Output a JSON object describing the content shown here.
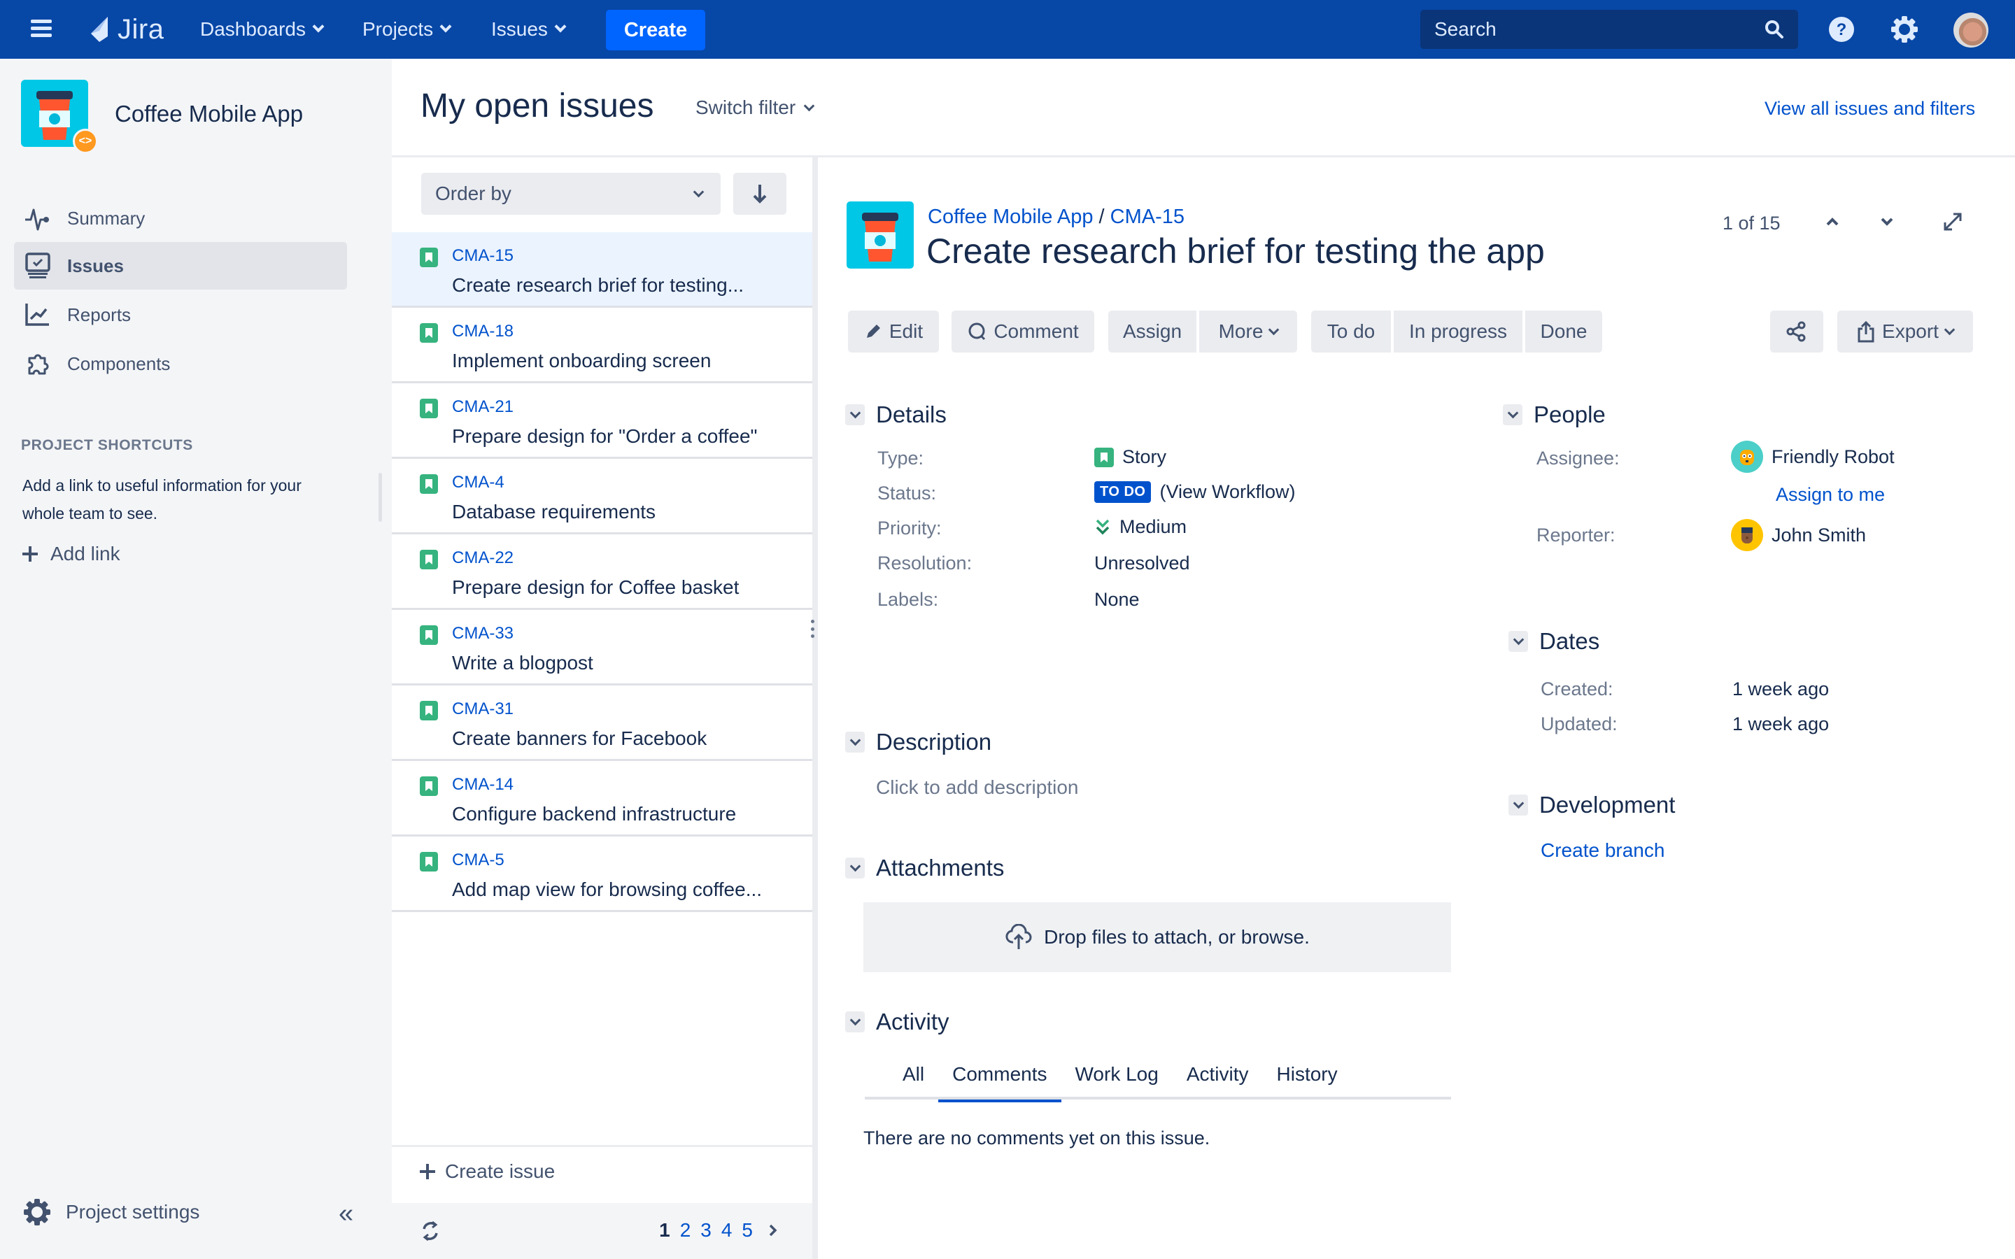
{
  "topnav": {
    "logo_text": "Jira",
    "menus": [
      "Dashboards",
      "Projects",
      "Issues"
    ],
    "create_label": "Create",
    "search_placeholder": "Search"
  },
  "sidebar": {
    "project_name": "Coffee Mobile App",
    "items": [
      {
        "label": "Summary",
        "icon": "pulse-icon",
        "active": false
      },
      {
        "label": "Issues",
        "icon": "issues-icon",
        "active": true
      },
      {
        "label": "Reports",
        "icon": "chart-icon",
        "active": false
      },
      {
        "label": "Components",
        "icon": "puzzle-icon",
        "active": false
      }
    ],
    "shortcuts_title": "PROJECT SHORTCUTS",
    "shortcuts_text": "Add a link to useful information for your whole team to see.",
    "add_link": "Add link",
    "project_settings": "Project settings"
  },
  "page": {
    "title": "My open issues",
    "switch_filter": "Switch filter",
    "view_all": "View all issues and filters"
  },
  "issue_list": {
    "order_by": "Order by",
    "issues": [
      {
        "key": "CMA-15",
        "summary": "Create research brief for testing...",
        "selected": true
      },
      {
        "key": "CMA-18",
        "summary": "Implement onboarding screen",
        "selected": false
      },
      {
        "key": "CMA-21",
        "summary": "Prepare design for \"Order a coffee\"",
        "selected": false
      },
      {
        "key": "CMA-4",
        "summary": "Database requirements",
        "selected": false
      },
      {
        "key": "CMA-22",
        "summary": "Prepare design for Coffee basket",
        "selected": false
      },
      {
        "key": "CMA-33",
        "summary": "Write a blogpost",
        "selected": false
      },
      {
        "key": "CMA-31",
        "summary": "Create banners for Facebook",
        "selected": false
      },
      {
        "key": "CMA-14",
        "summary": "Configure backend infrastructure",
        "selected": false
      },
      {
        "key": "CMA-5",
        "summary": "Add map view for browsing coffee...",
        "selected": false
      }
    ],
    "create_issue": "Create issue",
    "pages": [
      "1",
      "2",
      "3",
      "4",
      "5"
    ],
    "current_page": "1"
  },
  "detail": {
    "breadcrumb_project": "Coffee Mobile App",
    "breadcrumb_sep": " / ",
    "breadcrumb_key": "CMA-15",
    "title": "Create research brief for testing the app",
    "counter": "1 of 15",
    "buttons": {
      "edit": "Edit",
      "comment": "Comment",
      "assign": "Assign",
      "more": "More",
      "todo": "To do",
      "in_progress": "In progress",
      "done": "Done",
      "export": "Export"
    },
    "details": {
      "heading": "Details",
      "type_label": "Type:",
      "type_value": "Story",
      "status_label": "Status:",
      "status_value": "TO DO",
      "status_link": "(View Workflow)",
      "priority_label": "Priority:",
      "priority_value": "Medium",
      "resolution_label": "Resolution:",
      "resolution_value": "Unresolved",
      "labels_label": "Labels:",
      "labels_value": "None"
    },
    "people": {
      "heading": "People",
      "assignee_label": "Assignee:",
      "assignee": "Friendly Robot",
      "assign_to_me": "Assign to me",
      "reporter_label": "Reporter:",
      "reporter": "John Smith"
    },
    "dates": {
      "heading": "Dates",
      "created_label": "Created:",
      "created": "1 week ago",
      "updated_label": "Updated:",
      "updated": "1 week ago"
    },
    "development": {
      "heading": "Development",
      "create_branch": "Create branch"
    },
    "description": {
      "heading": "Description",
      "placeholder": "Click to add description"
    },
    "attachments": {
      "heading": "Attachments",
      "drop_text": "Drop files to attach, or browse."
    },
    "activity": {
      "heading": "Activity",
      "tabs": [
        "All",
        "Comments",
        "Work Log",
        "Activity",
        "History"
      ],
      "active_tab": "Comments",
      "empty": "There are no comments yet on this issue."
    }
  },
  "colors": {
    "nav_bg": "#0747A6",
    "create_btn": "#0065FF",
    "link": "#0052CC",
    "story_green": "#36B37E",
    "todo_blue": "#0052CC",
    "project_avatar": "#00C7E6",
    "project_badge": "#FF991F"
  }
}
